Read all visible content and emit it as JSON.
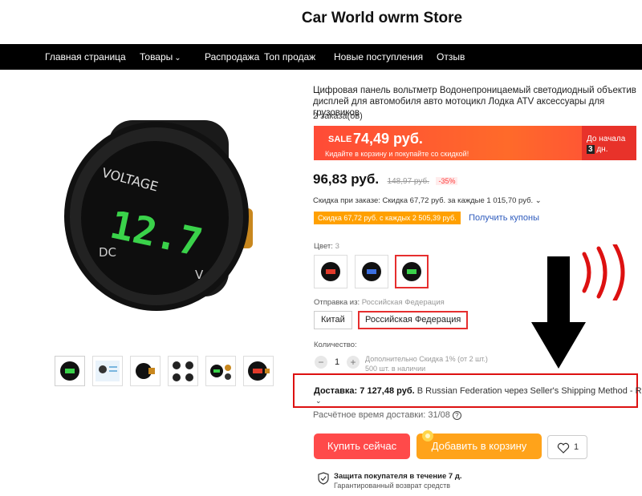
{
  "store": {
    "title": "Car World owrm Store"
  },
  "nav": {
    "items": [
      {
        "label": "Главная страница"
      },
      {
        "label": "Товары"
      },
      {
        "label": "Распродажа"
      },
      {
        "label": "Топ продаж"
      },
      {
        "label": "Новые поступления"
      },
      {
        "label": "Отзыв"
      }
    ]
  },
  "product": {
    "title": "Цифровая панель вольтметр Водонепроницаемый светодиодный объектив дисплей для автомобиля авто мотоцикл Лодка ATV аксессуары для грузовиков",
    "orders": "2 заказа(ов)",
    "image_text": {
      "brand": "VOLTAGE",
      "reading": "12.7",
      "dc": "DC",
      "v": "V"
    }
  },
  "sale": {
    "tag": "SALE",
    "price": "74,49 руб.",
    "subtitle": "Кидайте в корзину и покупайте со скидкой!",
    "countdown_prefix": "До начала",
    "countdown_days": "3",
    "countdown_unit": "дн."
  },
  "price": {
    "current": "96,83 руб.",
    "old": "148,97 руб.",
    "discount": "-35%"
  },
  "order_discount": "Скидка при заказе: Скидка 67,72 руб. за каждые 1 015,70 руб. ⌄",
  "coupon": {
    "chip": "Скидка 67,72 руб. с каждых 2 505,39 руб.",
    "link": "Получить купоны"
  },
  "color": {
    "label": "Цвет:",
    "value": "3"
  },
  "shipping_from": {
    "label": "Отправка из:",
    "value": "Российская Федерация",
    "options": [
      {
        "label": "Китай"
      },
      {
        "label": "Российская Федерация"
      }
    ]
  },
  "quantity": {
    "label": "Количество:",
    "minus": "−",
    "value": "1",
    "plus": "+",
    "note_line1": "Дополнительно Скидка 1% (от 2 шт.)",
    "note_line2": "500 шт. в наличии"
  },
  "delivery": {
    "label_bold": "Доставка: 7 127,48 руб.",
    "text": "В Russian Federation через Seller's Shipping Method - RU",
    "chevron": "⌄"
  },
  "eta": {
    "text": "Расчётное время доставки: 31/08",
    "help": "?"
  },
  "buttons": {
    "buy": "Купить сейчас",
    "cart": "Добавить в корзину",
    "wishlist_count": "1"
  },
  "protection": {
    "title": "Защита покупателя в течение 7 д.",
    "subtitle": "Гарантированный возврат средств"
  },
  "colors": {
    "sale_red": "#ff4b37",
    "buy_red": "#ff4a4a",
    "cart_orange": "#ffa31a",
    "annotation_red": "#dd1111",
    "link_blue": "#2e5bbd",
    "display_green": "#3ad24a"
  }
}
